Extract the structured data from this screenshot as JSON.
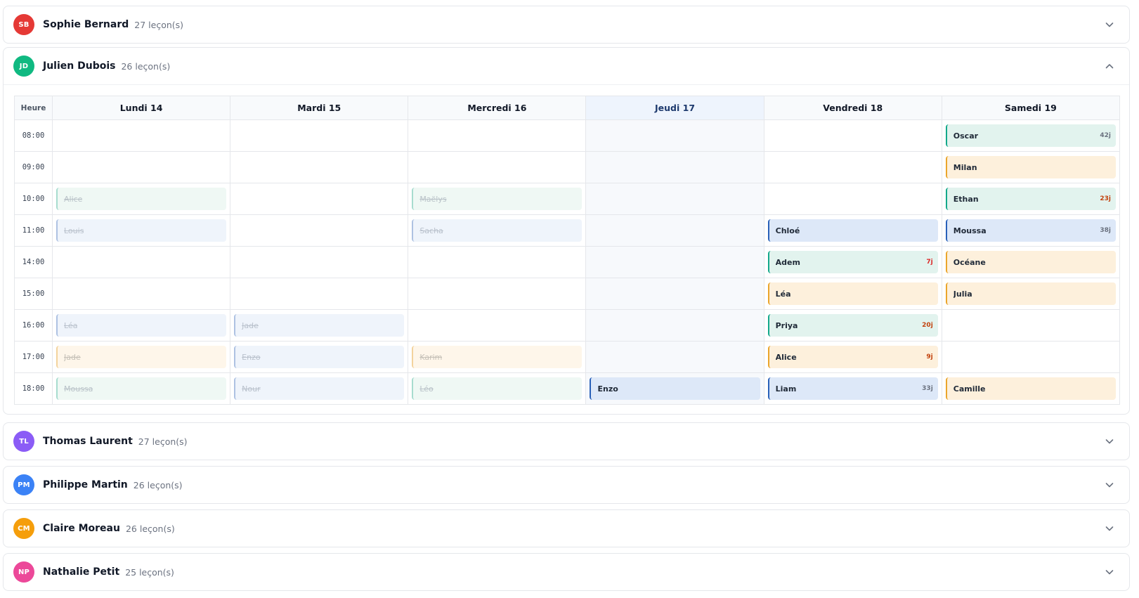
{
  "instructors": [
    {
      "initials": "SB",
      "name": "Sophie Bernard",
      "lessons": "27 leçon(s)",
      "color": "#e53935",
      "expanded": false
    },
    {
      "initials": "JD",
      "name": "Julien Dubois",
      "lessons": "26 leçon(s)",
      "color": "#10b981",
      "expanded": true,
      "schedule": {
        "time_header": "Heure",
        "days": [
          {
            "label": "Lundi 14",
            "today": false
          },
          {
            "label": "Mardi 15",
            "today": false
          },
          {
            "label": "Mercredi 16",
            "today": false
          },
          {
            "label": "Jeudi 17",
            "today": true
          },
          {
            "label": "Vendredi 18",
            "today": false
          },
          {
            "label": "Samedi 19",
            "today": false
          }
        ],
        "times": [
          "08:00",
          "09:00",
          "10:00",
          "11:00",
          "14:00",
          "15:00",
          "16:00",
          "17:00",
          "18:00"
        ],
        "events": [
          {
            "day": 5,
            "time": "08:00",
            "name": "Oscar",
            "variant": "green",
            "past": false,
            "badge": "42j",
            "badge_color": "#6b7280"
          },
          {
            "day": 5,
            "time": "09:00",
            "name": "Milan",
            "variant": "amber",
            "past": false
          },
          {
            "day": 0,
            "time": "10:00",
            "name": "Alice",
            "variant": "green",
            "past": true
          },
          {
            "day": 2,
            "time": "10:00",
            "name": "Maëlys",
            "variant": "green",
            "past": true
          },
          {
            "day": 5,
            "time": "10:00",
            "name": "Ethan",
            "variant": "green",
            "past": false,
            "badge": "23j",
            "badge_color": "#c2410c"
          },
          {
            "day": 0,
            "time": "11:00",
            "name": "Louis",
            "variant": "blue",
            "past": true
          },
          {
            "day": 2,
            "time": "11:00",
            "name": "Sacha",
            "variant": "blue",
            "past": true
          },
          {
            "day": 4,
            "time": "11:00",
            "name": "Chloé",
            "variant": "blue",
            "past": false
          },
          {
            "day": 5,
            "time": "11:00",
            "name": "Moussa",
            "variant": "blue",
            "past": false,
            "badge": "38j",
            "badge_color": "#6b7280"
          },
          {
            "day": 4,
            "time": "14:00",
            "name": "Adem",
            "variant": "green",
            "past": false,
            "badge": "7j",
            "badge_color": "#dc2626"
          },
          {
            "day": 5,
            "time": "14:00",
            "name": "Océane",
            "variant": "amber",
            "past": false
          },
          {
            "day": 4,
            "time": "15:00",
            "name": "Léa",
            "variant": "amber",
            "past": false
          },
          {
            "day": 5,
            "time": "15:00",
            "name": "Julia",
            "variant": "amber",
            "past": false
          },
          {
            "day": 0,
            "time": "16:00",
            "name": "Léa",
            "variant": "blue",
            "past": true
          },
          {
            "day": 1,
            "time": "16:00",
            "name": "Jade",
            "variant": "blue",
            "past": true
          },
          {
            "day": 4,
            "time": "16:00",
            "name": "Priya",
            "variant": "green",
            "past": false,
            "badge": "20j",
            "badge_color": "#c2410c"
          },
          {
            "day": 0,
            "time": "17:00",
            "name": "Jade",
            "variant": "amber",
            "past": true
          },
          {
            "day": 1,
            "time": "17:00",
            "name": "Enzo",
            "variant": "blue",
            "past": true
          },
          {
            "day": 2,
            "time": "17:00",
            "name": "Karim",
            "variant": "amber",
            "past": true
          },
          {
            "day": 4,
            "time": "17:00",
            "name": "Alice",
            "variant": "amber",
            "past": false,
            "badge": "9j",
            "badge_color": "#c2410c"
          },
          {
            "day": 0,
            "time": "18:00",
            "name": "Moussa",
            "variant": "green",
            "past": true
          },
          {
            "day": 1,
            "time": "18:00",
            "name": "Nour",
            "variant": "blue",
            "past": true
          },
          {
            "day": 2,
            "time": "18:00",
            "name": "Léo",
            "variant": "green",
            "past": true
          },
          {
            "day": 3,
            "time": "18:00",
            "name": "Enzo",
            "variant": "blue",
            "past": false
          },
          {
            "day": 4,
            "time": "18:00",
            "name": "Liam",
            "variant": "blue",
            "past": false,
            "badge": "33j",
            "badge_color": "#6b7280"
          },
          {
            "day": 5,
            "time": "18:00",
            "name": "Camille",
            "variant": "amber",
            "past": false
          }
        ]
      }
    },
    {
      "initials": "TL",
      "name": "Thomas Laurent",
      "lessons": "27 leçon(s)",
      "color": "#8b5cf6",
      "expanded": false
    },
    {
      "initials": "PM",
      "name": "Philippe Martin",
      "lessons": "26 leçon(s)",
      "color": "#3b82f6",
      "expanded": false
    },
    {
      "initials": "CM",
      "name": "Claire Moreau",
      "lessons": "26 leçon(s)",
      "color": "#f59e0b",
      "expanded": false
    },
    {
      "initials": "NP",
      "name": "Nathalie Petit",
      "lessons": "25 leçon(s)",
      "color": "#ec4899",
      "expanded": false
    }
  ],
  "icons": {
    "collapsed": "chevron-down-icon",
    "expanded": "chevron-up-icon"
  }
}
